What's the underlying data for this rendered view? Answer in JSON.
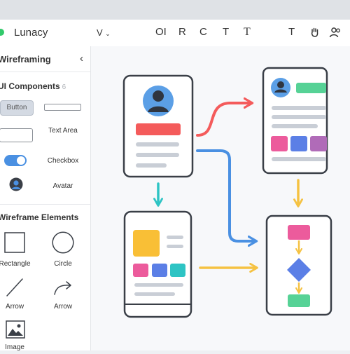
{
  "toolbar": {
    "app_title": "Lunacy",
    "menu_label": "V",
    "tools": [
      "OI",
      "R",
      "C",
      "T",
      "T",
      "T"
    ]
  },
  "sidebar": {
    "panel_title": "Wireframing",
    "components_title": "UI Components",
    "components_count": "6",
    "components": {
      "button": "Button",
      "text_area": "Text Area",
      "checkbox": "Checkbox",
      "avatar": "Avatar"
    },
    "elements_title": "Wireframe Elements",
    "elements": {
      "rectangle": "Rectangle",
      "circle": "Circle",
      "arrow_1": "Arrow",
      "arrow_2": "Arrow",
      "image": "Image"
    }
  },
  "colors": {
    "accent_blue": "#4a90e2",
    "red": "#f45b5b",
    "yellow": "#f5c242",
    "pink": "#ec5b9c",
    "purple": "#b06bb8",
    "teal": "#2ec4c4",
    "green": "#56d296",
    "frame_stroke": "#3a3f47",
    "placeholder_gray": "#c9ced6"
  }
}
